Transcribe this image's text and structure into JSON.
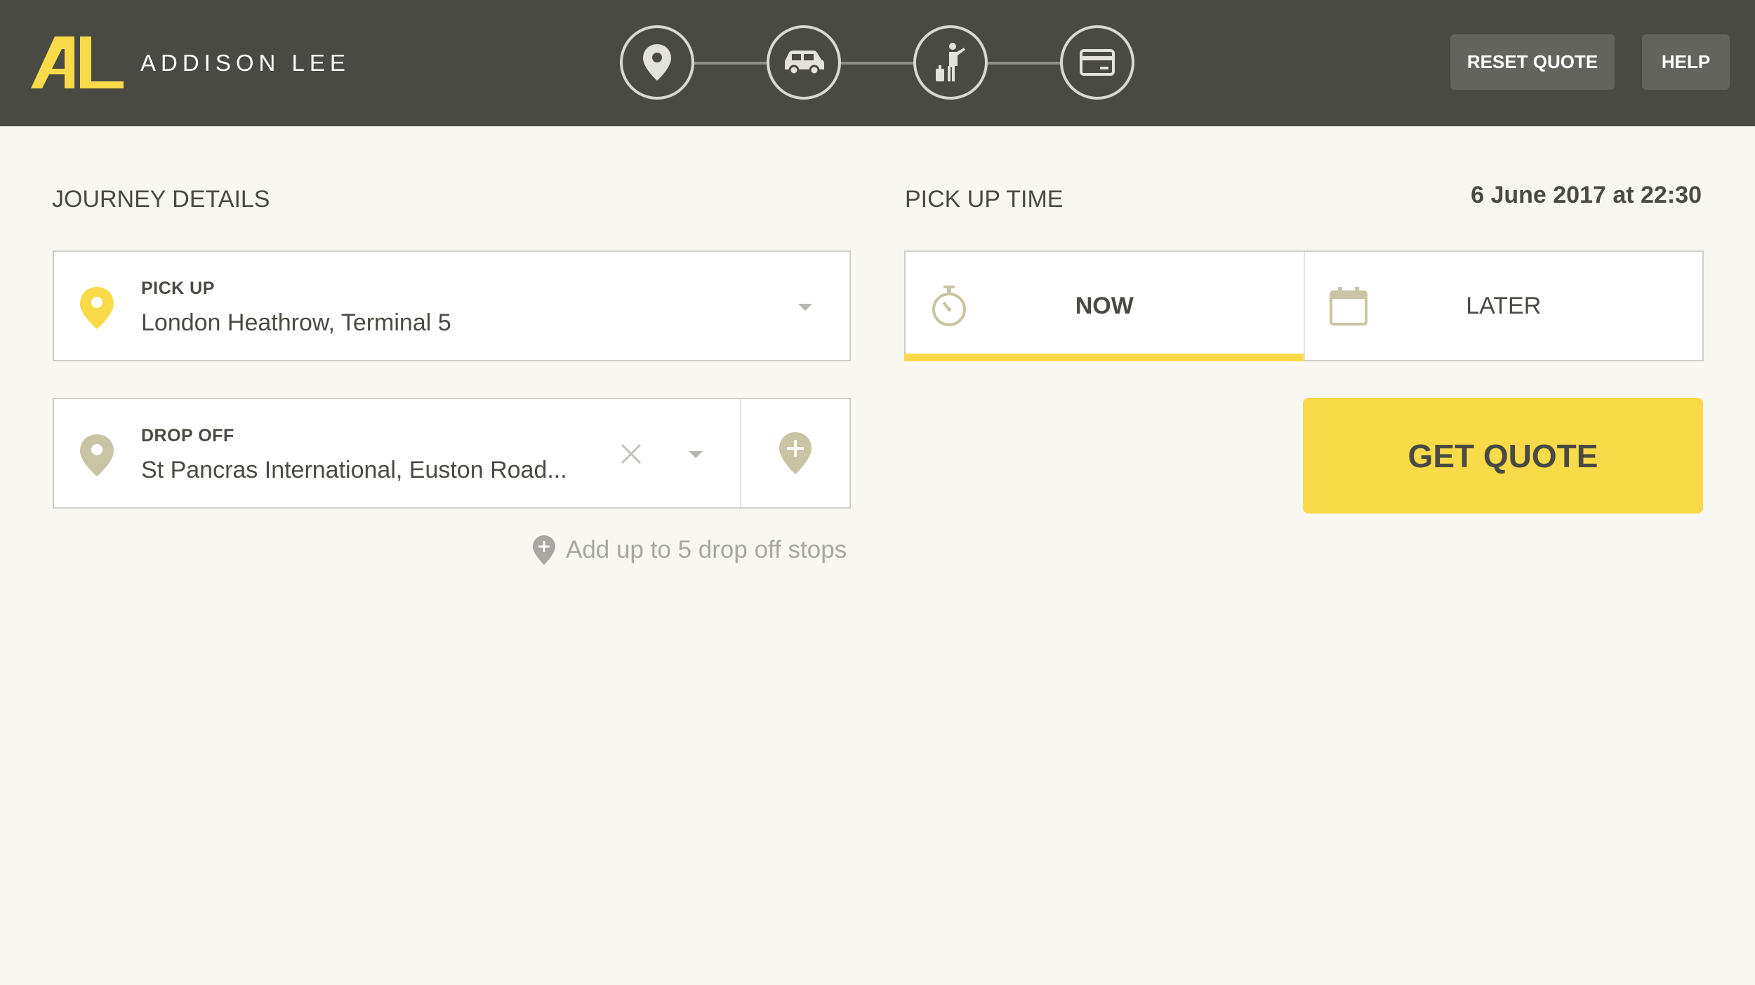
{
  "header": {
    "brand_name": "ADDISON LEE",
    "steps": [
      {
        "icon": "location-pin-icon",
        "state": "current"
      },
      {
        "icon": "car-icon",
        "state": "upcoming"
      },
      {
        "icon": "passenger-luggage-icon",
        "state": "upcoming"
      },
      {
        "icon": "payment-card-icon",
        "state": "upcoming"
      }
    ],
    "reset_label": "RESET QUOTE",
    "help_label": "HELP"
  },
  "journey": {
    "title": "JOURNEY DETAILS",
    "pickup": {
      "label": "PICK UP",
      "value": "London Heathrow, Terminal 5"
    },
    "dropoff": {
      "label": "DROP OFF",
      "value": "St Pancras International, Euston Road..."
    },
    "add_stops_hint": "Add up to 5 drop off stops"
  },
  "pickup_time": {
    "title": "PICK UP TIME",
    "datetime": "6 June 2017 at 22:30",
    "options": [
      {
        "label": "NOW",
        "icon": "stopwatch-icon",
        "selected": true
      },
      {
        "label": "LATER",
        "icon": "calendar-icon",
        "selected": false
      }
    ]
  },
  "quote_button_label": "GET QUOTE",
  "colors": {
    "header_bg": "#4a4a44",
    "accent_yellow": "#f9da48",
    "page_bg": "#f8f7f2",
    "muted_pin": "#c9c4a4",
    "text": "#4a4a45"
  }
}
